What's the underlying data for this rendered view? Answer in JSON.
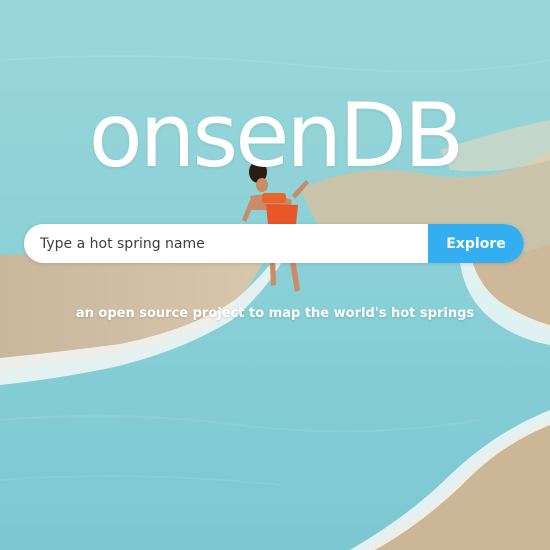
{
  "brand": {
    "logo_text": "onsenDB"
  },
  "search": {
    "placeholder": "Type a hot spring name",
    "value": "",
    "button_label": "Explore"
  },
  "tagline": "an open source project to map the world's hot springs",
  "colors": {
    "accent": "#33aef0",
    "water": "#8fd2d6",
    "text_on_image": "#ffffff"
  }
}
